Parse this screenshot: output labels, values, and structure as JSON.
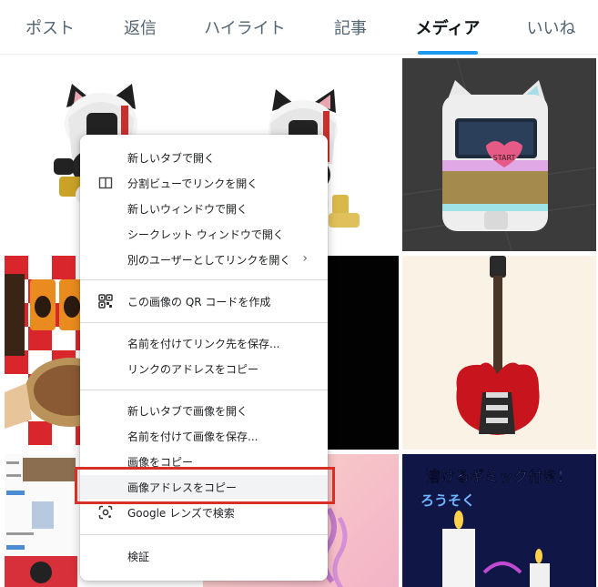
{
  "tabs": [
    {
      "label": "ポスト",
      "active": false
    },
    {
      "label": "返信",
      "active": false
    },
    {
      "label": "ハイライト",
      "active": false
    },
    {
      "label": "記事",
      "active": false
    },
    {
      "label": "メディア",
      "active": true
    },
    {
      "label": "いいね",
      "active": false
    }
  ],
  "accent_color": "#1d9bf0",
  "highlight_color": "#d93025",
  "menu": {
    "open_new_tab": "新しいタブで開く",
    "split_view": "分割ビューでリンクを開く",
    "open_new_window": "新しいウィンドウで開く",
    "open_incognito": "シークレット ウィンドウで開く",
    "open_as_user": "別のユーザーとしてリンクを開く",
    "qr_code": "この画像の QR コードを作成",
    "save_link_as": "名前を付けてリンク先を保存...",
    "copy_link": "リンクのアドレスをコピー",
    "open_image_new_tab": "新しいタブで画像を開く",
    "save_image_as": "名前を付けて画像を保存...",
    "copy_image": "画像をコピー",
    "copy_image_address": "画像アドレスをコピー",
    "google_lens": "Google レンズで検索",
    "inspect": "検証"
  },
  "thumbs": {
    "bag_text": "START",
    "poster_text_line1": "溶けるギミック付き！",
    "poster_text_line2": "ろうそく"
  }
}
